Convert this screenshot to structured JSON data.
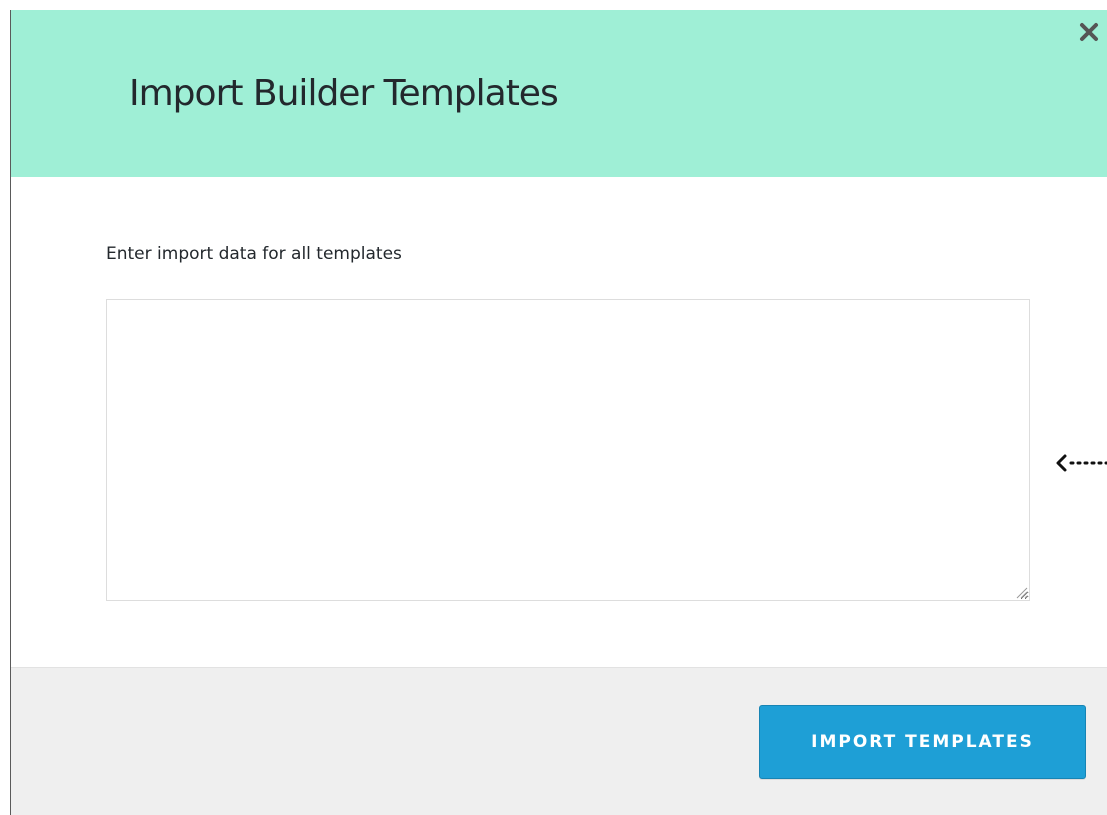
{
  "dialog": {
    "title": "Import Builder Templates",
    "close_icon": "close-icon",
    "header_color": "#9fefd6"
  },
  "form": {
    "label": "Enter import data for all templates",
    "textarea_value": "",
    "resize_icon": "resize-grip-icon"
  },
  "annotation": {
    "icon": "dotted-arrow-left-icon"
  },
  "footer": {
    "button_label": "IMPORT TEMPLATES",
    "button_color": "#1e9fd6"
  }
}
